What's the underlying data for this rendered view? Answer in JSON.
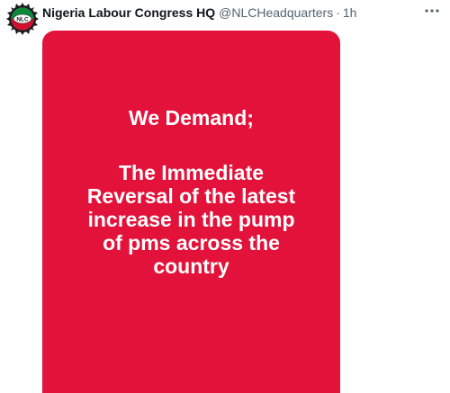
{
  "tweet": {
    "author": {
      "display_name": "Nigeria Labour Congress HQ",
      "handle": "@NLCHeadquarters",
      "avatar_label": "NLC"
    },
    "separator": "·",
    "timestamp": "1h",
    "more_icon": "more-horizontal-icon",
    "media": {
      "background_color": "#e3123a",
      "headline": "We Demand;",
      "lines": [
        "The Immediate",
        "Reversal of the latest",
        "increase in the pump",
        "of pms across the",
        "country"
      ]
    }
  }
}
